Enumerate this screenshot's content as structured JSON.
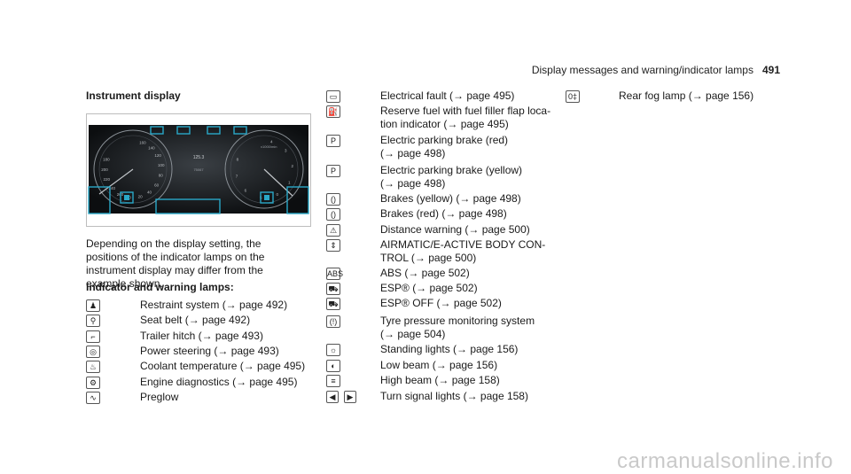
{
  "header": {
    "title": "Display messages and warning/indicator lamps",
    "page": "491"
  },
  "section_title": "Instrument display",
  "figure": {
    "left_gauge_ticks": [
      "160",
      "140",
      "120",
      "100",
      "80",
      "60",
      "40",
      "20",
      "0",
      "260",
      "240",
      "220",
      "200",
      "180"
    ],
    "right_gauge_ticks": [
      "4",
      "3",
      "2",
      "1",
      "0",
      "5",
      "6",
      "7",
      "8"
    ],
    "right_gauge_caption": "x1000/min",
    "center_lines": [
      "125.3",
      "75067"
    ]
  },
  "description": "Depending on the display setting, the positions of the indicator lamps on the instrument display may differ from the example shown.",
  "lamps_heading": "Indicator and warning lamps:",
  "col1": [
    {
      "icon": "restraint-system-icon",
      "glyph": "♟",
      "text": "Restraint system (→ page 492)"
    },
    {
      "icon": "seat-belt-icon",
      "glyph": "⚲",
      "text": "Seat belt (→ page 492)"
    },
    {
      "icon": "trailer-hitch-icon",
      "glyph": "⌐",
      "text": "Trailer hitch (→ page 493)"
    },
    {
      "icon": "power-steering-icon",
      "glyph": "◎",
      "text": "Power steering (→ page 493)"
    },
    {
      "icon": "coolant-temperature-icon",
      "glyph": "♨",
      "text": "Coolant temperature (→ page 495)"
    },
    {
      "icon": "engine-diagnostics-icon",
      "glyph": "⚙",
      "text": "Engine diagnostics (→ page 495)"
    },
    {
      "icon": "preglow-icon",
      "glyph": "∿",
      "text": "Preglow"
    }
  ],
  "col2": [
    {
      "icon": "electrical-fault-icon",
      "glyph": "▭",
      "lines": [
        "Electrical fault (→ page 495)"
      ]
    },
    {
      "icon": "fuel-reserve-icon",
      "glyph": "⛽",
      "lines": [
        "Reserve fuel with fuel filler flap loca-",
        "tion indicator (→ page 495)"
      ]
    },
    {
      "icon": "parking-brake-red-icon",
      "glyph": "P",
      "lines": [
        "Electric parking brake (red)",
        "(→ page 498)"
      ]
    },
    {
      "icon": "parking-brake-yellow-icon",
      "glyph": "P",
      "lines": [
        "Electric parking brake (yellow)",
        "(→ page 498)"
      ]
    },
    {
      "icon": "brakes-yellow-icon",
      "glyph": "()",
      "lines": [
        "Brakes (yellow) (→ page 498)"
      ]
    },
    {
      "icon": "brakes-red-icon",
      "glyph": "()",
      "lines": [
        "Brakes (red) (→ page 498)"
      ]
    },
    {
      "icon": "distance-warning-icon",
      "glyph": "⚠",
      "lines": [
        "Distance warning (→ page 500)"
      ]
    },
    {
      "icon": "airmatic-icon",
      "glyph": "⇕",
      "lines": [
        "AIRMATIC/E-ACTIVE BODY CON-",
        "TROL (→ page 500)"
      ]
    },
    {
      "icon": "abs-icon",
      "glyph": "ABS",
      "lines": [
        "ABS (→ page 502)"
      ]
    },
    {
      "icon": "esp-icon",
      "glyph": "⛟",
      "lines": [
        "ESP® (→ page 502)"
      ]
    },
    {
      "icon": "esp-off-icon",
      "glyph": "⛟",
      "lines": [
        "ESP® OFF (→ page 502)"
      ]
    },
    {
      "icon": "tyre-pressure-icon",
      "glyph": "(!)",
      "lines": [
        "Tyre pressure monitoring system",
        "(→ page 504)"
      ]
    },
    {
      "icon": "standing-lights-icon",
      "glyph": "☼",
      "lines": [
        "Standing lights (→ page 156)"
      ]
    },
    {
      "icon": "low-beam-icon",
      "glyph": "◐",
      "lines": [
        "Low beam (→ page 156)"
      ]
    },
    {
      "icon": "high-beam-icon",
      "glyph": "≡",
      "lines": [
        "High beam (→ page 158)"
      ]
    },
    {
      "icon": "turn-signal-icon",
      "glyph": "◀",
      "glyph2": "▶",
      "lines": [
        "Turn signal lights (→ page 158)"
      ]
    }
  ],
  "col3": [
    {
      "icon": "rear-fog-lamp-icon",
      "glyph": "0‡",
      "text": "Rear fog lamp (→ page 156)"
    }
  ],
  "watermark": "carmanualsonline.info"
}
